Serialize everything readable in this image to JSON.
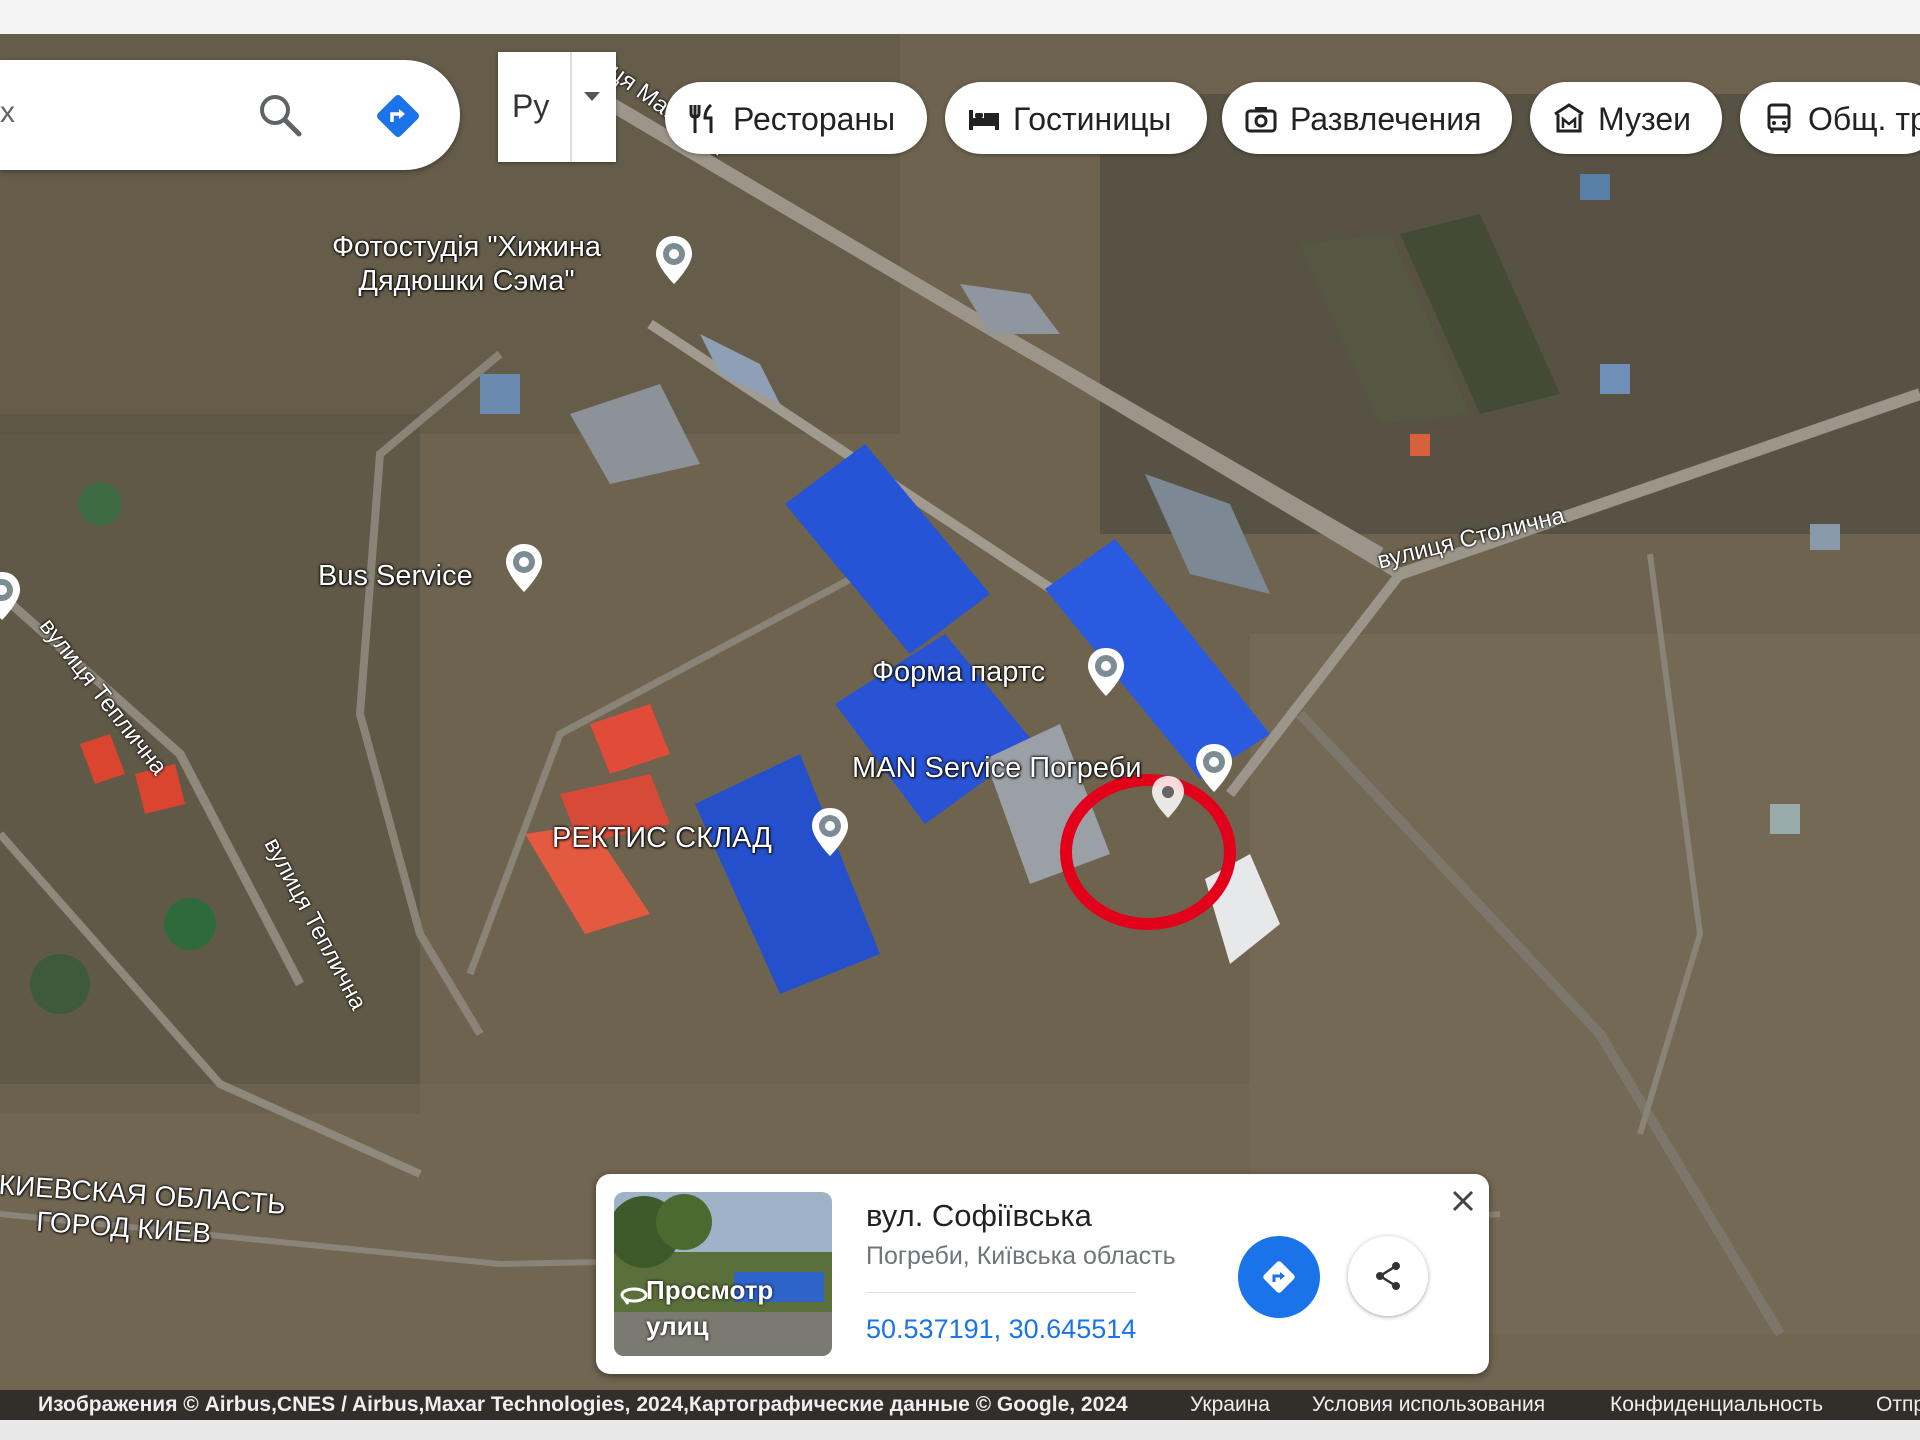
{
  "search": {
    "placeholder_fragment": "х"
  },
  "layers": {
    "label": "Ру"
  },
  "chips": [
    {
      "label": "Рестораны",
      "icon": "fork-knife-icon"
    },
    {
      "label": "Гостиницы",
      "icon": "bed-icon"
    },
    {
      "label": "Развлечения",
      "icon": "camera-icon"
    },
    {
      "label": "Музеи",
      "icon": "museum-icon"
    },
    {
      "label": "Общ. тр",
      "icon": "bus-icon"
    }
  ],
  "places": [
    {
      "name": "Фотостудія \"Хижина\nДядюшки Сэма\""
    },
    {
      "name": "Bus Service"
    },
    {
      "name": "Форма партс"
    },
    {
      "name": "MAN Service Погреби"
    },
    {
      "name": "РЕКТИС СКЛАД"
    }
  ],
  "streets": [
    {
      "name": "ця Ма...ська"
    },
    {
      "name": "вулиця Столична"
    },
    {
      "name": "вулиця Теплична"
    },
    {
      "name": "вулиця Теплична"
    }
  ],
  "region_label": {
    "line1": "КИЕВСКАЯ ОБЛАСТЬ",
    "line2": "ГОРОД КИЕВ"
  },
  "place_card": {
    "title": "вул. Софіївська",
    "subtitle": "Погреби, Київська область",
    "coordinates": "50.537191, 30.645514",
    "street_view_label": "Просмотр\nулиц"
  },
  "footer": {
    "attribution": "Изображения © Airbus,CNES / Airbus,Maxar Technologies, 2024,Картографические данные © Google, 2024",
    "country": "Украина",
    "terms": "Условия использования",
    "privacy": "Конфиденциальность",
    "feedback": "Отпр"
  },
  "colors": {
    "accent": "#1a73e8",
    "highlight_circle": "#e3001b"
  }
}
